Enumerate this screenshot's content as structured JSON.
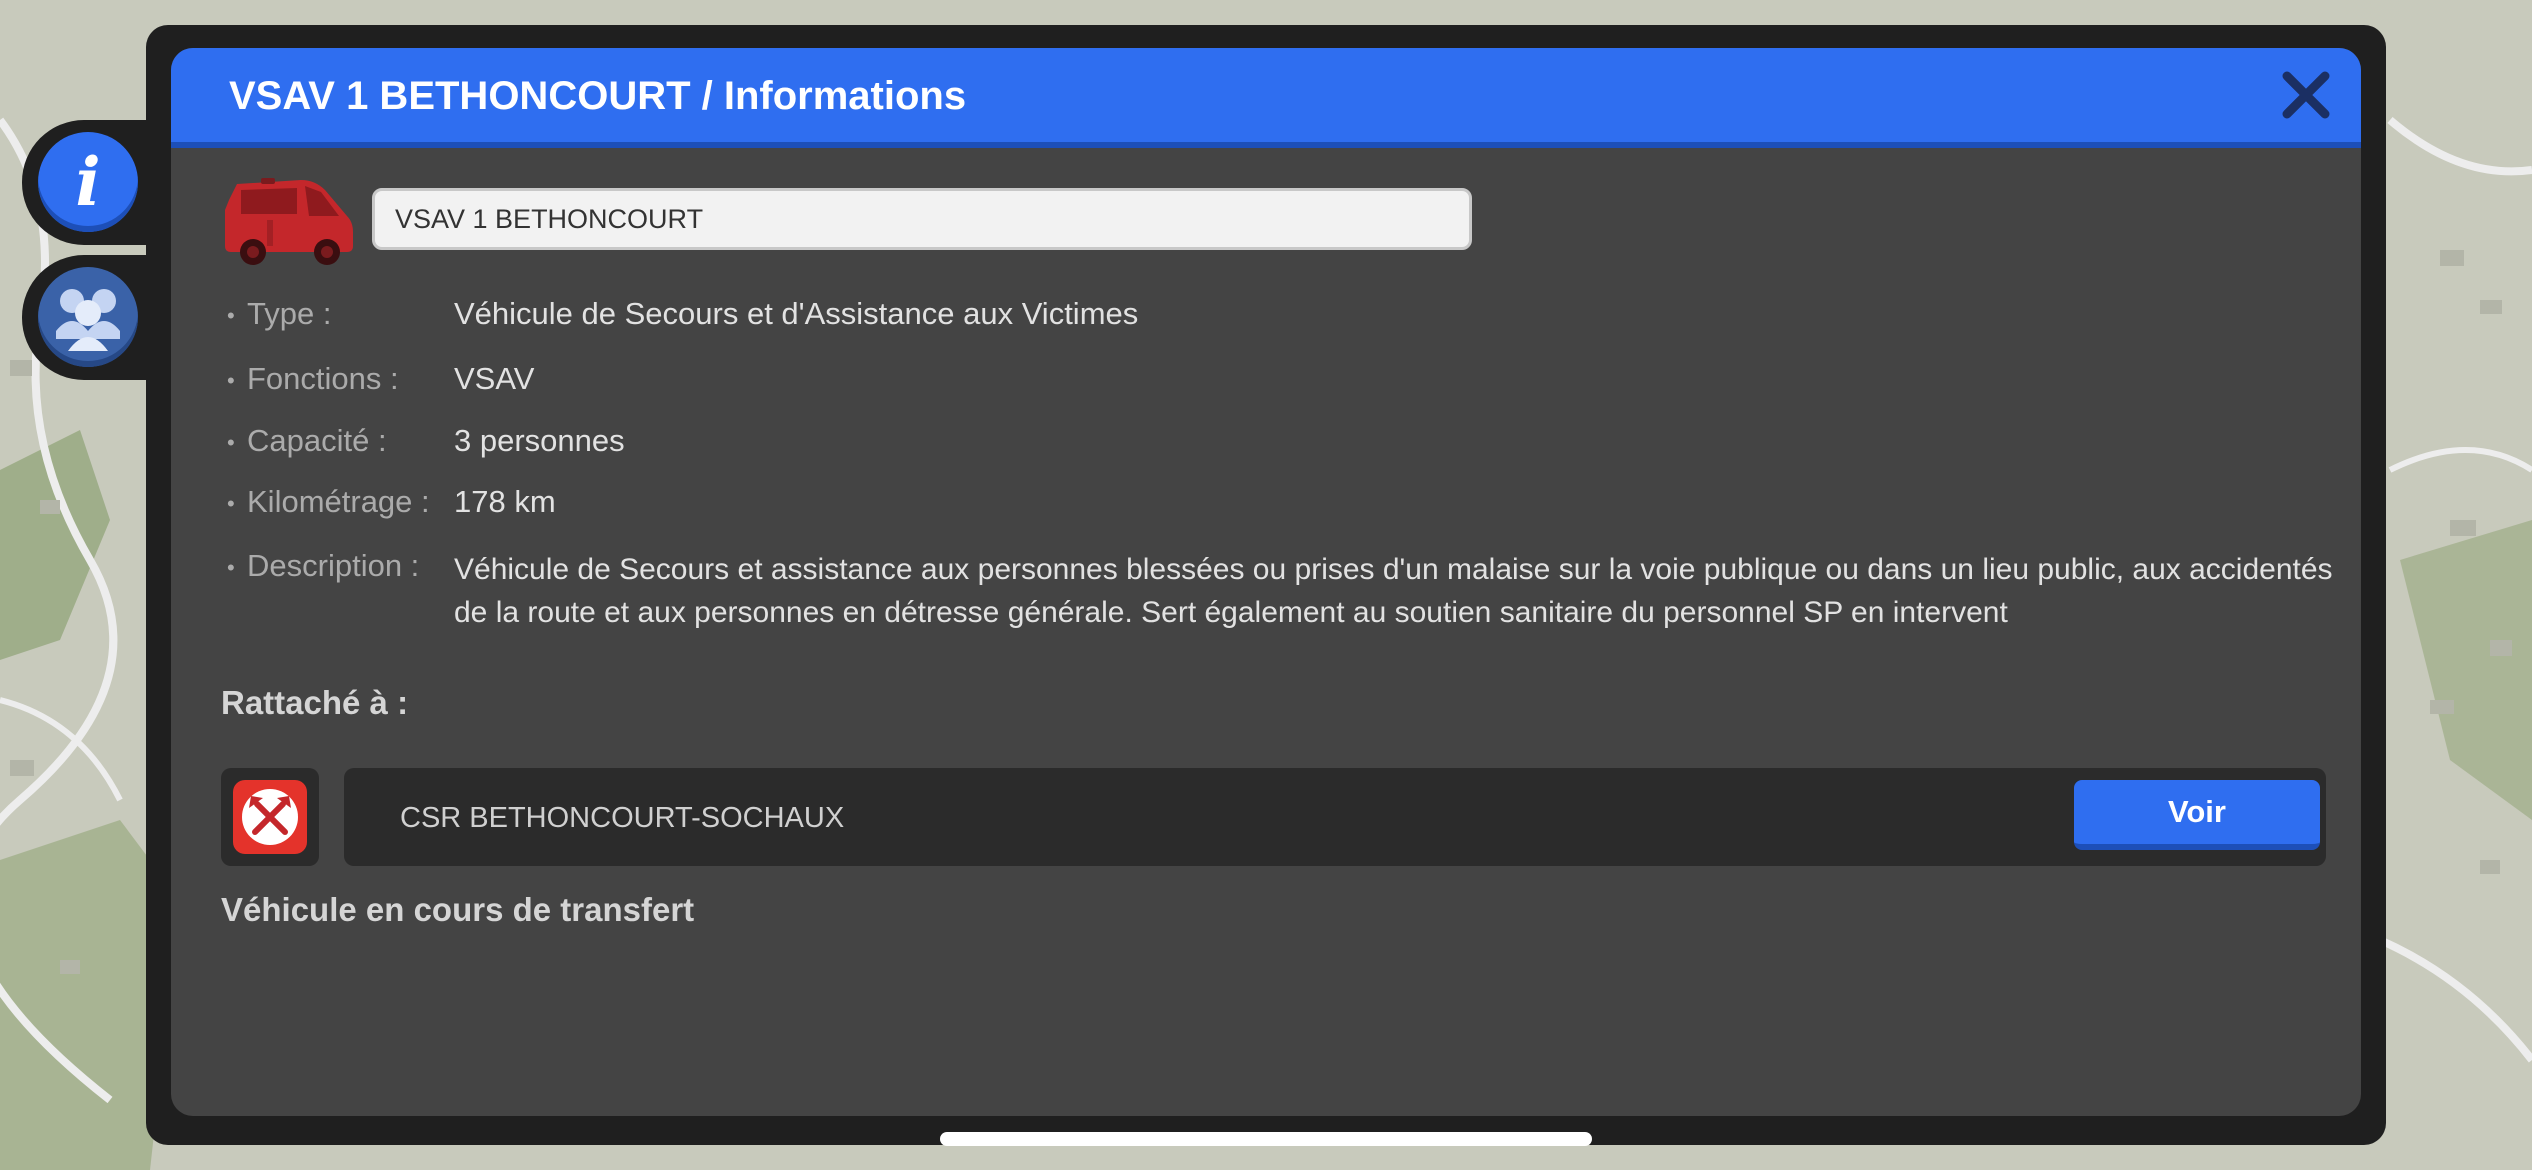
{
  "header": {
    "title": "VSAV 1 BETHONCOURT / Informations"
  },
  "side_tabs": [
    {
      "name": "info-tab",
      "icon": "info-icon",
      "active": true
    },
    {
      "name": "personnel-tab",
      "icon": "team-icon",
      "active": false
    }
  ],
  "vehicle": {
    "icon": "ambulance-van-icon",
    "name_value": "VSAV 1 BETHONCOURT"
  },
  "info": {
    "type_label": "Type :",
    "type_value": "Véhicule de Secours et d'Assistance aux Victimes",
    "functions_label": "Fonctions :",
    "functions_value": "VSAV",
    "capacity_label": "Capacité :",
    "capacity_value": "3 personnes",
    "mileage_label": "Kilométrage :",
    "mileage_value": "178 km",
    "description_label": "Description :",
    "description_value": "Véhicule de Secours et assistance aux personnes blessées ou prises d'un malaise sur la voie publique ou dans un lieu public, aux accidentés de la route et aux personnes en détresse générale. Sert également au soutien sanitaire du personnel SP en intervent"
  },
  "attached": {
    "label": "Rattaché à :",
    "station_icon": "fire-station-axes-icon",
    "station_name": "CSR BETHONCOURT-SOCHAUX",
    "view_button": "Voir"
  },
  "status": {
    "text": "Véhicule en cours de transfert"
  },
  "colors": {
    "accent_blue": "#2f6ef0",
    "panel_bg": "#444444",
    "frame_bg": "#1f1f1f",
    "vehicle_red": "#c4272b",
    "map_bg": "#c9cbbd"
  }
}
